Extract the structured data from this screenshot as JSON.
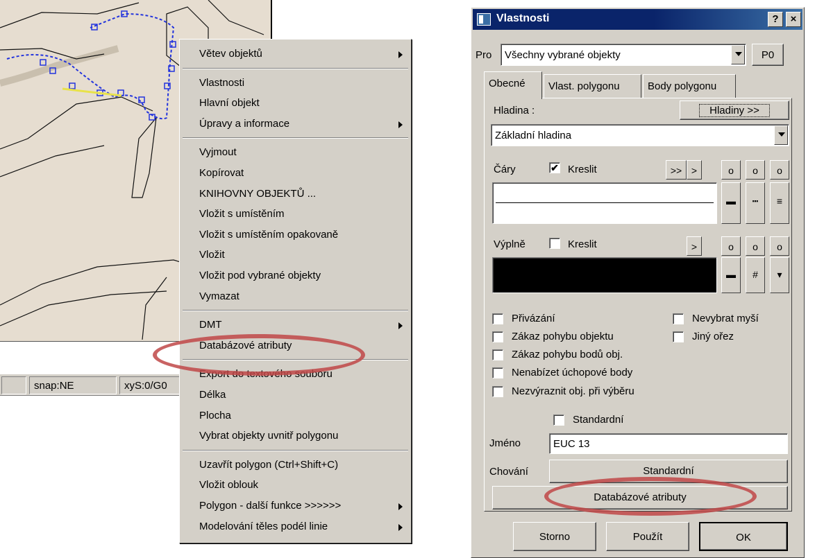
{
  "status": {
    "snap": "snap:NE",
    "xys": "xyS:0/G0"
  },
  "context_menu": {
    "items": [
      {
        "label": "Větev objektů",
        "submenu": true
      },
      {
        "sep": true
      },
      {
        "label": "Vlastnosti"
      },
      {
        "label": "Hlavní objekt"
      },
      {
        "label": "Úpravy a informace",
        "submenu": true
      },
      {
        "sep": true
      },
      {
        "label": "Vyjmout"
      },
      {
        "label": "Kopírovat"
      },
      {
        "label": "KNIHOVNY OBJEKTŮ ..."
      },
      {
        "label": "Vložit s umístěním"
      },
      {
        "label": "Vložit s umístěním opakovaně"
      },
      {
        "label": "Vložit"
      },
      {
        "label": "Vložit pod vybrané objekty"
      },
      {
        "label": "Vymazat"
      },
      {
        "sep": true
      },
      {
        "label": "DMT",
        "submenu": true
      },
      {
        "label": "Databázové atributy",
        "highlight": true
      },
      {
        "sep": true
      },
      {
        "label": "Export do textového souboru"
      },
      {
        "label": "Délka"
      },
      {
        "label": "Plocha"
      },
      {
        "label": "Vybrat objekty uvnitř polygonu"
      },
      {
        "sep": true
      },
      {
        "label": "Uzavřít polygon (Ctrl+Shift+C)"
      },
      {
        "label": "Vložit oblouk"
      },
      {
        "label": "Polygon - další funkce >>>>>>",
        "submenu": true
      },
      {
        "label": "Modelování těles podél linie",
        "submenu": true
      }
    ]
  },
  "dialog": {
    "title": "Vlastnosti",
    "help_btn": "?",
    "close_btn": "×",
    "pro_label": "Pro",
    "pro_value": "Všechny vybrané objekty",
    "p0_btn": "P0",
    "tabs": [
      "Obecné",
      "Vlast. polygonu",
      "Body polygonu"
    ],
    "hladina_label": "Hladina :",
    "hladiny_btn": "Hladiny >>",
    "hladina_value": "Základní hladina",
    "cary_label": "Čáry",
    "kreslit": "Kreslit",
    "cary_kreslit_checked": true,
    "btn_double_arrow": ">>",
    "btn_arrow": ">",
    "btn_o": "o",
    "vyplne_label": "Výplně",
    "vyplne_kreslit_checked": false,
    "fill_color": "#000000",
    "checks_left": [
      "Přivázání",
      "Zákaz pohybu objektu",
      "Zákaz pohybu bodů obj.",
      "Nenabízet úchopové body",
      "Nezvýraznit obj. při výběru"
    ],
    "checks_right": [
      "Nevybrat myší",
      "Jiný ořez"
    ],
    "standard_check": "Standardní",
    "jmeno_label": "Jméno",
    "jmeno_value": "EUC 13",
    "chovani_label": "Chování",
    "chovani_btn": "Standardní",
    "db_btn": "Databázové atributy",
    "storno": "Storno",
    "pouzit": "Použít",
    "ok": "OK"
  },
  "colors": {
    "highlight_ring": "#c04848",
    "titlebar": "#0a246a",
    "face": "#d4d0c8"
  }
}
